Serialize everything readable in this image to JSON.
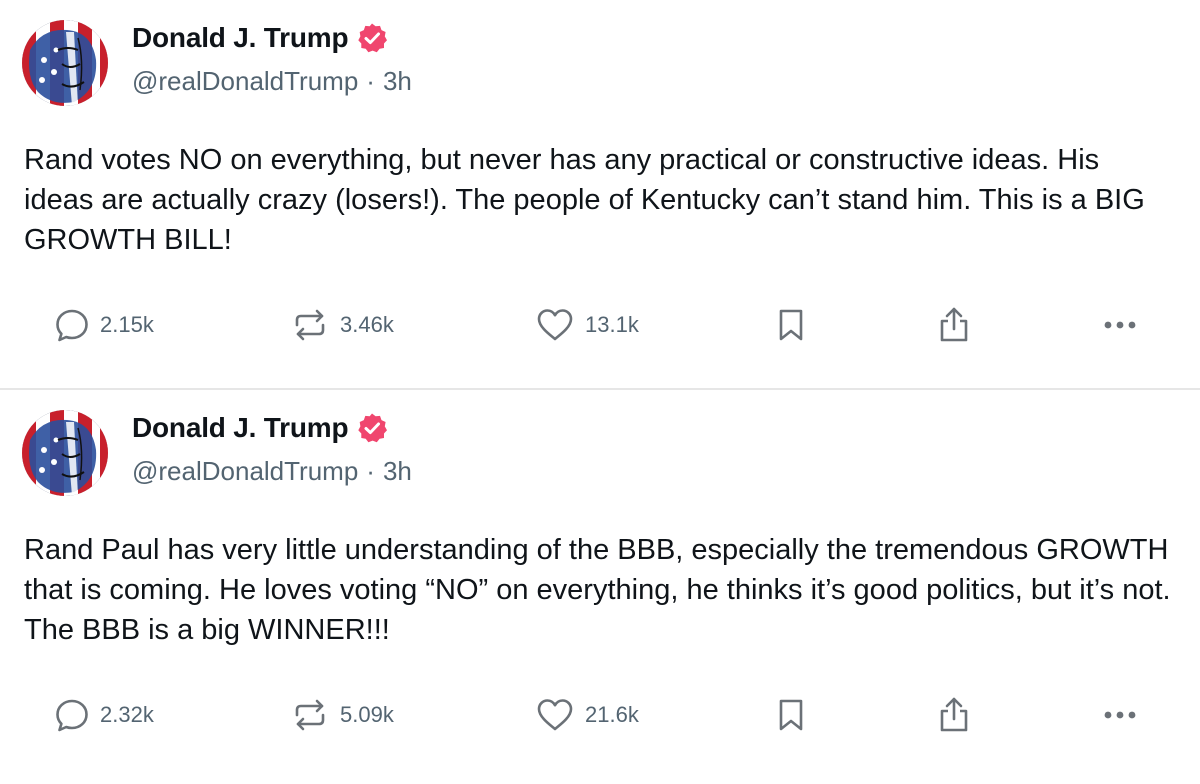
{
  "posts": [
    {
      "author_name": "Donald J. Trump",
      "verified_icon": "verified-badge-icon",
      "handle": "@realDonaldTrump",
      "separator": "·",
      "time": "3h",
      "text": "Rand votes NO on everything, but never has any practical or constructive ideas. His ideas are actually crazy (losers!). The people of Kentucky can’t stand him. This is a BIG GROWTH BILL!",
      "stats": {
        "replies": "2.15k",
        "reposts": "3.46k",
        "likes": "13.1k"
      }
    },
    {
      "author_name": "Donald J. Trump",
      "verified_icon": "verified-badge-icon",
      "handle": "@realDonaldTrump",
      "separator": "·",
      "time": "3h",
      "text": "Rand Paul has very little understanding of the BBB, especially the tremendous GROWTH that is coming. He loves voting “NO” on everything, he thinks it’s good politics, but it’s not. The BBB is a big WINNER!!!",
      "stats": {
        "replies": "2.32k",
        "reposts": "5.09k",
        "likes": "21.6k"
      }
    }
  ],
  "icons": {
    "reply": "comment-bubble-icon",
    "repost": "repost-arrows-icon",
    "like": "heart-icon",
    "bookmark": "bookmark-icon",
    "share": "share-upload-icon",
    "more": "more-dots-icon"
  },
  "colors": {
    "text": "#0f1419",
    "secondary": "#536471",
    "verified_badge": "#f0466e",
    "divider": "#e6e6e6",
    "icon": "#6b7177"
  }
}
